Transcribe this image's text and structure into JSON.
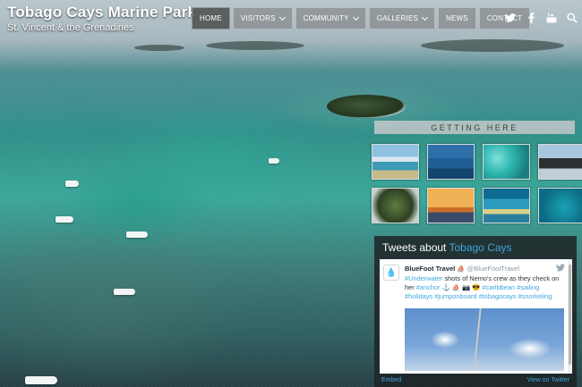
{
  "header": {
    "title": "Tobago Cays Marine Park",
    "subtitle": "St. Vincent & the Grenadines"
  },
  "nav": {
    "items": [
      {
        "label": "HOME",
        "active": true,
        "has_dropdown": false
      },
      {
        "label": "VISITORS",
        "active": false,
        "has_dropdown": true
      },
      {
        "label": "COMMUNITY",
        "active": false,
        "has_dropdown": true
      },
      {
        "label": "GALLERIES",
        "active": false,
        "has_dropdown": true
      },
      {
        "label": "NEWS",
        "active": false,
        "has_dropdown": false
      },
      {
        "label": "CONTACT",
        "active": false,
        "has_dropdown": false
      }
    ],
    "social_icons": [
      "twitter-icon",
      "facebook-icon",
      "youtube-icon",
      "search-icon"
    ]
  },
  "getting_here": {
    "title": "GETTING HERE",
    "thumbnails": [
      "beach-thumbnail",
      "harbour-thumbnail",
      "coral-thumbnail",
      "shoreline-thumbnail",
      "tree-thumbnail",
      "sunset-thumbnail",
      "turtle-thumbnail",
      "reef-thumbnail"
    ]
  },
  "tweets": {
    "title_prefix": "Tweets about ",
    "title_highlight": "Tobago Cays",
    "tweet": {
      "author_name": "BlueFoot Travel",
      "author_handle": "@BlueFootTravel",
      "text_parts": [
        "#Underwater",
        " shots of Nemo's crew as they check on her ",
        "#anchor",
        " ⚓ ⛵ 📷 😎  ",
        "#caribbean #sailing",
        " ",
        "#holidays #jumponboard #tobagocays #snorkeling"
      ]
    },
    "footer_embed": "Embed",
    "footer_view": "View on Twitter"
  },
  "colors": {
    "accent": "#3fa7dc",
    "nav_bg": "#787878",
    "bar_bg": "#c3c8c8"
  }
}
